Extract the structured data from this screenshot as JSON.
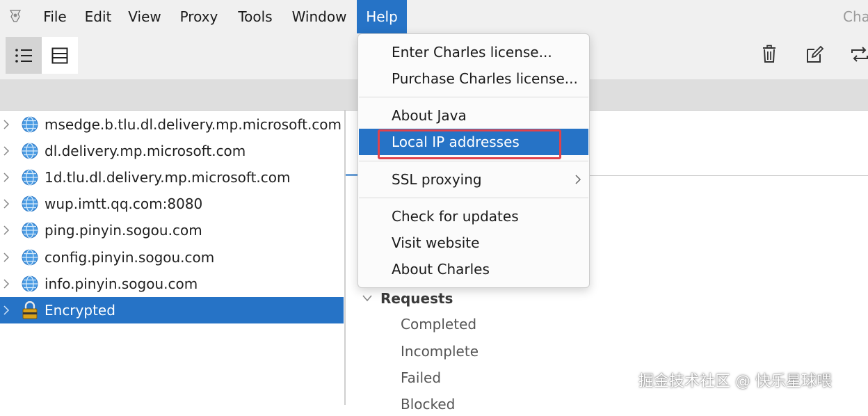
{
  "window": {
    "title": "Cha"
  },
  "menubar": {
    "items": [
      "File",
      "Edit",
      "View",
      "Proxy",
      "Tools",
      "Window",
      "Help"
    ],
    "active": "Help"
  },
  "toolbar": {
    "left_buttons": [
      "structure-view",
      "sequence-view"
    ],
    "right_buttons": [
      "trash-icon",
      "edit-icon",
      "repeat-icon"
    ]
  },
  "tree": {
    "items": [
      {
        "label": "msedge.b.tlu.dl.delivery.mp.microsoft.com",
        "icon": "globe-icon"
      },
      {
        "label": "dl.delivery.mp.microsoft.com",
        "icon": "globe-icon"
      },
      {
        "label": "1d.tlu.dl.delivery.mp.microsoft.com",
        "icon": "globe-icon"
      },
      {
        "label": "wup.imtt.qq.com:8080",
        "icon": "globe-icon"
      },
      {
        "label": "ping.pinyin.sogou.com",
        "icon": "globe-icon"
      },
      {
        "label": "config.pinyin.sogou.com",
        "icon": "globe-icon"
      },
      {
        "label": "info.pinyin.sogou.com",
        "icon": "globe-icon"
      },
      {
        "label": "Encrypted",
        "icon": "lock-icon",
        "selected": true
      }
    ]
  },
  "help_menu": {
    "items": [
      {
        "label": "Enter Charles license..."
      },
      {
        "label": "Purchase Charles license..."
      },
      {
        "label": "About Java"
      },
      {
        "label": "Local IP addresses",
        "highlighted": true
      },
      {
        "label": "SSL proxying",
        "submenu": true
      },
      {
        "label": "Check for updates"
      },
      {
        "label": "Visit website"
      },
      {
        "label": "About Charles"
      }
    ]
  },
  "summary": {
    "section": "Requests",
    "items": [
      "Completed",
      "Incomplete",
      "Failed",
      "Blocked"
    ]
  },
  "colors": {
    "accent": "#2673c6",
    "annotation": "#e0424b",
    "menubar_bg": "#f0f0f0"
  },
  "watermark": "掘金技术社区 @ 快乐星球喂"
}
